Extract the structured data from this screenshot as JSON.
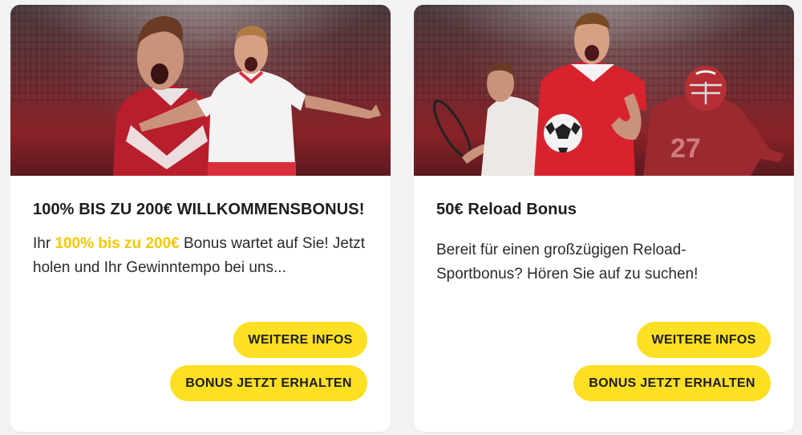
{
  "cards": [
    {
      "banner_alt": "football-players-cheering",
      "title": "100% BIS ZU 200€ WILLKOMMENSBONUS!",
      "desc_prefix": "Ihr ",
      "desc_highlight": "100% bis zu 200€",
      "desc_suffix": " Bonus wartet auf Sie! Jetzt holen und Ihr Gewinntempo bei uns...",
      "more_info_label": "WEITERE INFOS",
      "get_bonus_label": "BONUS JETZT ERHALTEN"
    },
    {
      "banner_alt": "multi-sport-athletes",
      "title": "50€ Reload Bonus",
      "desc": "Bereit für einen großzügigen Reload-Sportbonus? Hören Sie auf zu suchen!",
      "more_info_label": "WEITERE INFOS",
      "get_bonus_label": "BONUS JETZT ERHALTEN"
    }
  ],
  "colors": {
    "accent": "#fddf24",
    "highlight_text": "#f5c800",
    "card_bg": "#ffffff",
    "page_bg": "#f2f2f4",
    "banner_red": "#8a2228"
  }
}
